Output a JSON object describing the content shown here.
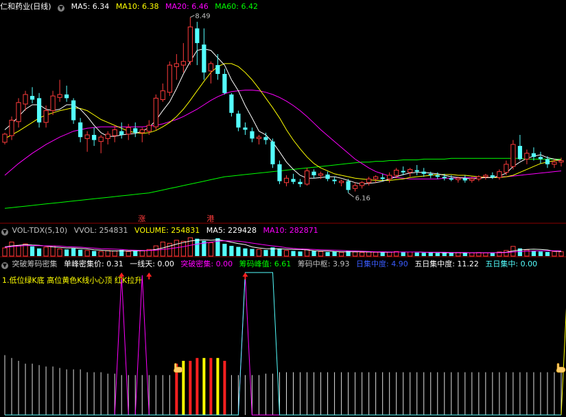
{
  "colors": {
    "up": "#ff3b3b",
    "down": "#54ffff",
    "ma5": "#ffffff",
    "ma10": "#ffff00",
    "ma20": "#ff00ff",
    "ma60": "#00ff00",
    "divider": "#8b0000"
  },
  "price_panel": {
    "title": "仁和药业(日线)",
    "ma5_label": "MA5: 6.34",
    "ma10_label": "MA10: 6.38",
    "ma20_label": "MA20: 6.46",
    "ma60_label": "MA60: 6.42",
    "high_label": "8.49",
    "low_label": "6.16",
    "event_marks": [
      "涨",
      "港"
    ]
  },
  "volume_panel": {
    "title": "VOL-TDX(5,10)",
    "vvol_label": "VVOL: 254831",
    "volume_label": "VOLUME: 254831",
    "ma5_label": "MA5: 229428",
    "ma10_label": "MA10: 282871"
  },
  "indicator_panel": {
    "title": "突破筹码密集",
    "items": [
      {
        "label": "单峰密集价: 0.31",
        "color": "#ffffff"
      },
      {
        "label": "一线天: 0.00",
        "color": "#ffffff"
      },
      {
        "label": "突破密集: 0.00",
        "color": "#ff00ff"
      },
      {
        "label": "筹码峰值: 6.61",
        "color": "#00ff00"
      },
      {
        "label": "筹码中枢: 3.93",
        "color": "#c0c0c0"
      },
      {
        "label": "日集中度: 4.90",
        "color": "#3a5cff"
      },
      {
        "label": "五日集中度: 11.22",
        "color": "#ffffff"
      },
      {
        "label": "五日集中: 0.00",
        "color": "#54ffff"
      }
    ],
    "note": "1.低位绿K底 高位黄色K线小心顶 红K拉升"
  },
  "chart_data": {
    "type": "candlestick",
    "candles": [
      [
        6.85,
        6.98,
        6.82,
        6.96
      ],
      [
        6.94,
        7.2,
        6.88,
        7.15
      ],
      [
        7.13,
        7.45,
        7.05,
        7.39
      ],
      [
        7.37,
        7.55,
        7.28,
        7.5
      ],
      [
        7.48,
        7.6,
        7.38,
        7.43
      ],
      [
        7.45,
        7.52,
        7.05,
        7.12
      ],
      [
        7.12,
        7.35,
        7.05,
        7.28
      ],
      [
        7.28,
        7.55,
        7.22,
        7.48
      ],
      [
        7.46,
        7.7,
        7.4,
        7.5
      ],
      [
        7.5,
        7.62,
        7.4,
        7.45
      ],
      [
        7.42,
        7.45,
        7.1,
        7.15
      ],
      [
        7.12,
        7.18,
        6.85,
        6.92
      ],
      [
        6.9,
        7.0,
        6.72,
        6.95
      ],
      [
        6.95,
        7.05,
        6.8,
        6.88
      ],
      [
        6.86,
        6.95,
        6.7,
        6.92
      ],
      [
        6.9,
        7.0,
        6.82,
        6.96
      ],
      [
        6.94,
        7.08,
        6.85,
        7.02
      ],
      [
        7.0,
        7.12,
        6.9,
        6.95
      ],
      [
        6.96,
        7.1,
        6.88,
        7.05
      ],
      [
        7.04,
        7.12,
        6.92,
        6.98
      ],
      [
        6.98,
        7.05,
        6.85,
        7.02
      ],
      [
        7.0,
        7.15,
        6.95,
        7.08
      ],
      [
        7.06,
        7.5,
        7.02,
        7.45
      ],
      [
        7.43,
        7.65,
        7.4,
        7.55
      ],
      [
        7.53,
        7.95,
        7.48,
        7.9
      ],
      [
        7.88,
        8.05,
        7.7,
        7.92
      ],
      [
        7.9,
        8.2,
        7.8,
        7.95
      ],
      [
        7.95,
        8.55,
        7.9,
        8.42
      ],
      [
        8.4,
        8.49,
        7.9,
        8.2
      ],
      [
        8.18,
        8.4,
        7.7,
        7.8
      ],
      [
        7.82,
        7.95,
        7.65,
        7.92
      ],
      [
        7.9,
        8.05,
        7.7,
        7.78
      ],
      [
        7.78,
        7.85,
        7.5,
        7.52
      ],
      [
        7.5,
        7.52,
        7.2,
        7.25
      ],
      [
        7.24,
        7.28,
        7.0,
        7.05
      ],
      [
        7.05,
        7.12,
        6.95,
        7.02
      ],
      [
        7.0,
        7.05,
        6.85,
        6.9
      ],
      [
        6.9,
        6.95,
        6.82,
        6.92
      ],
      [
        6.92,
        6.98,
        6.82,
        6.88
      ],
      [
        6.86,
        6.9,
        6.5,
        6.55
      ],
      [
        6.55,
        6.6,
        6.28,
        6.32
      ],
      [
        6.3,
        6.4,
        6.25,
        6.36
      ],
      [
        6.35,
        6.42,
        6.28,
        6.31
      ],
      [
        6.31,
        6.35,
        6.24,
        6.28
      ],
      [
        6.28,
        6.5,
        6.26,
        6.46
      ],
      [
        6.45,
        6.48,
        6.36,
        6.4
      ],
      [
        6.4,
        6.45,
        6.35,
        6.42
      ],
      [
        6.41,
        6.45,
        6.32,
        6.35
      ],
      [
        6.34,
        6.38,
        6.28,
        6.32
      ],
      [
        6.3,
        6.34,
        6.25,
        6.32
      ],
      [
        6.32,
        6.35,
        6.16,
        6.2
      ],
      [
        6.22,
        6.3,
        6.18,
        6.26
      ],
      [
        6.26,
        6.32,
        6.22,
        6.3
      ],
      [
        6.3,
        6.38,
        6.26,
        6.35
      ],
      [
        6.35,
        6.4,
        6.3,
        6.38
      ],
      [
        6.37,
        6.42,
        6.32,
        6.35
      ],
      [
        6.35,
        6.44,
        6.3,
        6.4
      ],
      [
        6.4,
        6.5,
        6.36,
        6.47
      ],
      [
        6.46,
        6.52,
        6.4,
        6.44
      ],
      [
        6.44,
        6.5,
        6.38,
        6.48
      ],
      [
        6.47,
        6.54,
        6.4,
        6.45
      ],
      [
        6.45,
        6.5,
        6.38,
        6.42
      ],
      [
        6.42,
        6.45,
        6.36,
        6.4
      ],
      [
        6.4,
        6.44,
        6.35,
        6.38
      ],
      [
        6.38,
        6.42,
        6.33,
        6.36
      ],
      [
        6.36,
        6.4,
        6.32,
        6.34
      ],
      [
        6.34,
        6.38,
        6.3,
        6.36
      ],
      [
        6.36,
        6.4,
        6.3,
        6.33
      ],
      [
        6.33,
        6.38,
        6.3,
        6.35
      ],
      [
        6.35,
        6.4,
        6.32,
        6.38
      ],
      [
        6.38,
        6.42,
        6.34,
        6.4
      ],
      [
        6.4,
        6.44,
        6.35,
        6.37
      ],
      [
        6.37,
        6.48,
        6.34,
        6.45
      ],
      [
        6.44,
        6.6,
        6.4,
        6.55
      ],
      [
        6.52,
        6.88,
        6.48,
        6.82
      ],
      [
        6.8,
        6.95,
        6.6,
        6.62
      ],
      [
        6.62,
        6.75,
        6.55,
        6.7
      ],
      [
        6.7,
        6.78,
        6.6,
        6.65
      ],
      [
        6.65,
        6.72,
        6.56,
        6.62
      ],
      [
        6.62,
        6.66,
        6.5,
        6.55
      ],
      [
        6.55,
        6.62,
        6.5,
        6.58
      ],
      [
        6.58,
        6.64,
        6.52,
        6.6
      ]
    ],
    "ma5": [
      7.02,
      7.1,
      7.2,
      7.3,
      7.36,
      7.36,
      7.3,
      7.28,
      7.3,
      7.36,
      7.36,
      7.3,
      7.2,
      7.08,
      6.98,
      6.93,
      6.93,
      6.95,
      6.96,
      6.97,
      7.0,
      7.05,
      7.15,
      7.28,
      7.4,
      7.58,
      7.78,
      7.95,
      8.1,
      8.12,
      8.1,
      8.0,
      7.9,
      7.7,
      7.55,
      7.35,
      7.18,
      7.0,
      6.95,
      6.85,
      6.72,
      6.58,
      6.48,
      6.4,
      6.36,
      6.36,
      6.37,
      6.38,
      6.38,
      6.36,
      6.33,
      6.3,
      6.28,
      6.29,
      6.3,
      6.32,
      6.35,
      6.38,
      6.41,
      6.43,
      6.44,
      6.44,
      6.43,
      6.42,
      6.4,
      6.38,
      6.37,
      6.36,
      6.35,
      6.36,
      6.37,
      6.37,
      6.39,
      6.43,
      6.52,
      6.58,
      6.63,
      6.66,
      6.68,
      6.64,
      6.62,
      6.6
    ],
    "ma10": [
      6.9,
      6.95,
      7.0,
      7.06,
      7.12,
      7.18,
      7.22,
      7.25,
      7.28,
      7.3,
      7.32,
      7.31,
      7.28,
      7.22,
      7.16,
      7.12,
      7.08,
      7.04,
      7.0,
      6.98,
      6.97,
      6.98,
      7.01,
      7.06,
      7.12,
      7.2,
      7.3,
      7.42,
      7.55,
      7.68,
      7.8,
      7.88,
      7.92,
      7.92,
      7.88,
      7.8,
      7.7,
      7.58,
      7.45,
      7.32,
      7.18,
      7.02,
      6.88,
      6.76,
      6.65,
      6.56,
      6.5,
      6.46,
      6.42,
      6.4,
      6.38,
      6.36,
      6.35,
      6.34,
      6.33,
      6.33,
      6.33,
      6.34,
      6.35,
      6.37,
      6.38,
      6.39,
      6.4,
      6.41,
      6.41,
      6.41,
      6.4,
      6.4,
      6.39,
      6.38,
      6.37,
      6.37,
      6.37,
      6.38,
      6.4,
      6.44,
      6.48,
      6.52,
      6.56,
      6.58,
      6.6,
      6.61
    ],
    "ma20": [
      6.4,
      6.48,
      6.56,
      6.63,
      6.7,
      6.76,
      6.82,
      6.87,
      6.92,
      6.96,
      7.0,
      7.02,
      7.04,
      7.05,
      7.06,
      7.06,
      7.06,
      7.06,
      7.06,
      7.06,
      7.06,
      7.07,
      7.08,
      7.1,
      7.13,
      7.16,
      7.2,
      7.25,
      7.3,
      7.36,
      7.42,
      7.47,
      7.51,
      7.54,
      7.55,
      7.56,
      7.56,
      7.55,
      7.53,
      7.5,
      7.46,
      7.41,
      7.35,
      7.28,
      7.2,
      7.11,
      7.02,
      6.94,
      6.86,
      6.78,
      6.7,
      6.62,
      6.56,
      6.5,
      6.45,
      6.42,
      6.39,
      6.37,
      6.36,
      6.35,
      6.35,
      6.35,
      6.35,
      6.35,
      6.36,
      6.36,
      6.36,
      6.37,
      6.37,
      6.37,
      6.37,
      6.37,
      6.38,
      6.38,
      6.39,
      6.4,
      6.41,
      6.42,
      6.43,
      6.44,
      6.45,
      6.46
    ],
    "ma60": [
      5.95,
      5.96,
      5.97,
      5.98,
      5.99,
      6.0,
      6.01,
      6.02,
      6.03,
      6.04,
      6.05,
      6.06,
      6.07,
      6.08,
      6.09,
      6.1,
      6.11,
      6.12,
      6.13,
      6.14,
      6.15,
      6.16,
      6.18,
      6.2,
      6.22,
      6.24,
      6.26,
      6.28,
      6.3,
      6.32,
      6.34,
      6.36,
      6.38,
      6.39,
      6.4,
      6.41,
      6.42,
      6.43,
      6.44,
      6.45,
      6.46,
      6.47,
      6.48,
      6.49,
      6.5,
      6.51,
      6.52,
      6.53,
      6.54,
      6.55,
      6.56,
      6.57,
      6.58,
      6.58,
      6.59,
      6.59,
      6.6,
      6.6,
      6.61,
      6.61,
      6.61,
      6.62,
      6.62,
      6.62,
      6.62,
      6.63,
      6.63,
      6.63,
      6.63,
      6.63,
      6.63,
      6.63,
      6.63,
      6.63,
      6.63,
      6.63,
      6.62,
      6.62,
      6.62,
      6.62,
      6.62,
      6.62
    ],
    "volume": [
      0.32,
      0.55,
      0.42,
      0.48,
      0.38,
      0.3,
      0.35,
      0.4,
      0.28,
      0.26,
      0.3,
      0.25,
      0.22,
      0.2,
      0.18,
      0.22,
      0.2,
      0.24,
      0.18,
      0.2,
      0.22,
      0.26,
      0.4,
      0.55,
      0.5,
      0.62,
      0.58,
      0.72,
      0.68,
      0.6,
      0.52,
      0.7,
      0.48,
      0.4,
      0.36,
      0.3,
      0.28,
      0.26,
      0.24,
      0.34,
      0.3,
      0.22,
      0.2,
      0.18,
      0.26,
      0.2,
      0.18,
      0.16,
      0.18,
      0.15,
      0.2,
      0.16,
      0.14,
      0.16,
      0.15,
      0.14,
      0.16,
      0.18,
      0.15,
      0.16,
      0.14,
      0.13,
      0.14,
      0.12,
      0.13,
      0.12,
      0.14,
      0.12,
      0.13,
      0.14,
      0.13,
      0.12,
      0.16,
      0.22,
      0.38,
      0.3,
      0.24,
      0.2,
      0.18,
      0.16,
      0.18,
      0.17
    ],
    "vol_ma5": [
      0.36,
      0.4,
      0.42,
      0.45,
      0.43,
      0.42,
      0.39,
      0.36,
      0.34,
      0.32,
      0.32,
      0.3,
      0.28,
      0.25,
      0.23,
      0.21,
      0.2,
      0.21,
      0.2,
      0.21,
      0.21,
      0.22,
      0.26,
      0.32,
      0.39,
      0.47,
      0.53,
      0.59,
      0.62,
      0.64,
      0.62,
      0.64,
      0.6,
      0.54,
      0.49,
      0.45,
      0.36,
      0.32,
      0.29,
      0.28,
      0.28,
      0.27,
      0.26,
      0.26,
      0.24,
      0.21,
      0.2,
      0.2,
      0.18,
      0.17,
      0.17,
      0.17,
      0.17,
      0.16,
      0.16,
      0.15,
      0.15,
      0.16,
      0.16,
      0.16,
      0.16,
      0.15,
      0.14,
      0.14,
      0.13,
      0.13,
      0.13,
      0.13,
      0.13,
      0.13,
      0.13,
      0.13,
      0.14,
      0.15,
      0.2,
      0.24,
      0.26,
      0.27,
      0.26,
      0.24,
      0.19,
      0.18
    ],
    "vol_ma10": [
      0.34,
      0.37,
      0.39,
      0.41,
      0.41,
      0.41,
      0.4,
      0.4,
      0.39,
      0.37,
      0.36,
      0.35,
      0.33,
      0.31,
      0.29,
      0.28,
      0.27,
      0.26,
      0.24,
      0.23,
      0.22,
      0.22,
      0.23,
      0.26,
      0.29,
      0.33,
      0.37,
      0.42,
      0.47,
      0.51,
      0.54,
      0.58,
      0.6,
      0.59,
      0.58,
      0.55,
      0.51,
      0.47,
      0.43,
      0.4,
      0.37,
      0.33,
      0.3,
      0.28,
      0.27,
      0.26,
      0.25,
      0.24,
      0.23,
      0.22,
      0.21,
      0.2,
      0.19,
      0.18,
      0.17,
      0.17,
      0.16,
      0.16,
      0.16,
      0.16,
      0.16,
      0.15,
      0.15,
      0.15,
      0.15,
      0.14,
      0.14,
      0.14,
      0.13,
      0.13,
      0.13,
      0.13,
      0.13,
      0.14,
      0.16,
      0.18,
      0.19,
      0.2,
      0.21,
      0.21,
      0.21,
      0.21
    ],
    "indicator": {
      "bars": [
        0.42,
        0.4,
        0.38,
        0.36,
        0.36,
        0.35,
        0.34,
        0.34,
        0.33,
        0.32,
        0.32,
        0.32,
        0.3,
        0.3,
        0.3,
        0.29,
        0.29,
        0.28,
        0.28,
        0.28,
        0.28,
        0.28,
        0.28,
        0.28,
        0.28,
        0.28,
        0.28,
        0.28,
        0.28,
        0.28,
        0.27,
        0.27,
        0.27,
        0.28,
        0.28,
        0.28,
        0.28,
        0.28,
        0.29,
        0.29,
        0.3,
        0.3,
        0.3,
        0.3,
        0.3,
        0.3,
        0.3,
        0.3,
        0.3,
        0.3,
        0.3,
        0.3,
        0.3,
        0.3,
        0.3,
        0.3,
        0.3,
        0.3,
        0.3,
        0.3,
        0.3,
        0.3,
        0.3,
        0.3,
        0.3,
        0.3,
        0.3,
        0.3,
        0.3,
        0.3,
        0.3,
        0.3,
        0.3,
        0.3,
        0.3,
        0.3,
        0.3,
        0.3,
        0.3,
        0.3,
        0.3,
        0.3
      ],
      "highlight_bars": [
        {
          "i": 25,
          "v": 0.36,
          "color": "#ff2020"
        },
        {
          "i": 26,
          "v": 0.38,
          "color": "#ffff00"
        },
        {
          "i": 27,
          "v": 0.38,
          "color": "#ff2020"
        },
        {
          "i": 28,
          "v": 0.4,
          "color": "#ff2020"
        },
        {
          "i": 29,
          "v": 0.4,
          "color": "#ffff00"
        },
        {
          "i": 30,
          "v": 0.4,
          "color": "#ff2020"
        },
        {
          "i": 31,
          "v": 0.4,
          "color": "#ffff00"
        },
        {
          "i": 32,
          "v": 0.38,
          "color": "#ff2020"
        }
      ],
      "magenta_line": [
        0,
        0,
        0,
        0,
        0,
        0,
        0,
        0,
        0,
        0,
        0,
        0,
        0,
        0,
        0,
        0,
        0,
        1,
        0,
        0,
        1,
        0,
        0,
        0,
        0,
        0,
        0,
        0,
        0,
        0,
        0,
        0,
        0,
        0,
        0,
        1,
        0,
        0,
        0,
        0,
        0,
        0,
        0,
        0,
        0,
        0,
        0,
        0,
        0,
        0,
        0,
        0,
        0,
        0,
        0,
        0,
        0,
        0,
        0,
        0,
        0,
        0,
        0,
        0,
        0,
        0,
        0,
        0,
        0,
        0,
        0,
        0,
        0,
        0,
        0,
        0,
        0,
        0,
        0,
        0,
        0,
        0
      ],
      "cyan_line": [
        0,
        0,
        0,
        0,
        0,
        0,
        0,
        0,
        0,
        0,
        0,
        0,
        0,
        0,
        0,
        0,
        0,
        0,
        0,
        0,
        0,
        0,
        0,
        0,
        0,
        0,
        0,
        0,
        0,
        0,
        0,
        0,
        0,
        0,
        0,
        0,
        0,
        0,
        0,
        0,
        0,
        0,
        0,
        0,
        0,
        0,
        0,
        0,
        0,
        0,
        0,
        0,
        0,
        0,
        0,
        0,
        0,
        0,
        0,
        0,
        0,
        0,
        0,
        0,
        0,
        0,
        0,
        0,
        0,
        0,
        0,
        0,
        0,
        0,
        0,
        0,
        0,
        0,
        0,
        0,
        0,
        0
      ],
      "yellow_line": [
        0,
        0,
        0,
        0,
        0,
        0,
        0,
        0,
        0,
        0,
        0,
        0,
        0,
        0,
        0,
        0,
        0,
        0,
        0,
        0,
        0,
        0,
        0,
        0,
        0,
        0,
        0,
        0,
        0,
        0,
        0,
        0,
        0,
        0,
        0,
        0,
        0,
        0,
        0,
        0,
        0,
        0,
        0,
        0,
        0,
        0,
        0,
        0,
        0,
        0,
        0,
        0,
        0,
        0,
        0,
        0,
        0,
        0,
        0,
        0,
        0,
        0,
        0,
        0,
        0,
        0,
        0,
        0,
        0,
        0,
        0,
        0,
        0,
        0,
        0,
        0,
        0,
        0,
        0,
        0,
        0,
        0
      ],
      "arrow_indexes": [
        17,
        21,
        35
      ],
      "hand_indexes": [
        25,
        90
      ]
    }
  }
}
